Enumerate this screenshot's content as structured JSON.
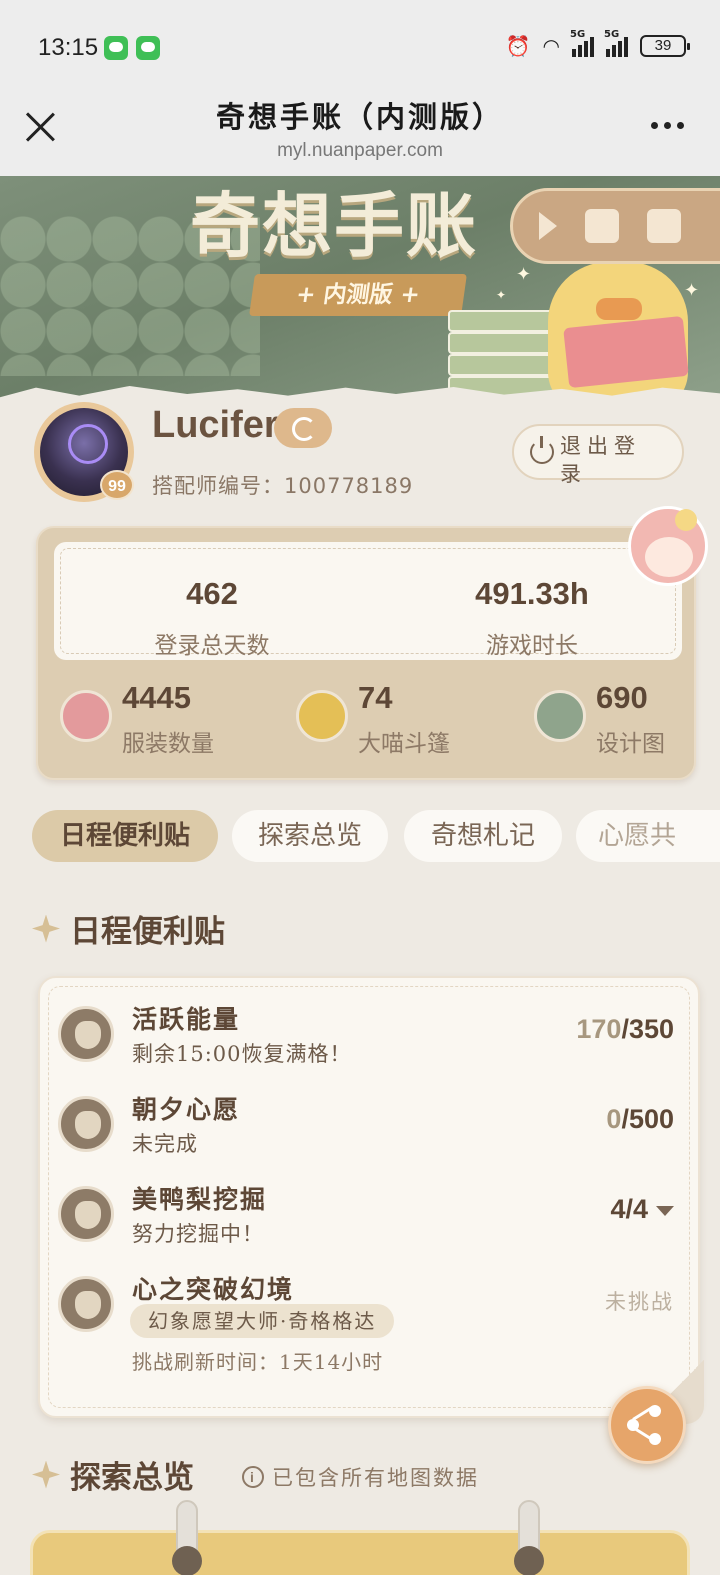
{
  "status_bar": {
    "time": "13:15",
    "network_label": "5G",
    "battery": "39"
  },
  "nav": {
    "title": "奇想手账（内测版）",
    "url": "myl.nuanpaper.com"
  },
  "banner": {
    "title": "奇想手账",
    "badge": "+ 内测版 +"
  },
  "profile": {
    "username": "Lucifer",
    "level": "99",
    "designer_id_label": "搭配师编号：",
    "designer_id": "100778189",
    "logout_label": "退出登录"
  },
  "stats": {
    "login_days": "462",
    "login_days_label": "登录总天数",
    "play_time": "491.33h",
    "play_time_label": "游戏时长",
    "outfits": "4445",
    "outfits_label": "服装数量",
    "cloaks": "74",
    "cloaks_label": "大喵斗篷",
    "designs": "690",
    "designs_label": "设计图"
  },
  "tabs": [
    "日程便利贴",
    "探索总览",
    "奇想札记",
    "心愿共"
  ],
  "schedule": {
    "heading": "日程便利贴",
    "rows": [
      {
        "title": "活跃能量",
        "sub": "剩余15:00恢复满格！",
        "value_dim": "170",
        "value": "/350"
      },
      {
        "title": "朝夕心愿",
        "sub": "未完成",
        "value_dim": "0",
        "value": "/500"
      },
      {
        "title": "美鸭梨挖掘",
        "sub": "努力挖掘中！",
        "value_dim": "",
        "value": "4/4"
      },
      {
        "title": "心之突破幻境",
        "chip": "幻象愿望大师·奇格格达",
        "sub": "挑战刷新时间：1天14小时",
        "status": "未挑战"
      }
    ]
  },
  "explore": {
    "heading": "探索总览",
    "note": "已包含所有地图数据"
  },
  "colors": {
    "accent": "#e6a56a",
    "brown": "#5d4736",
    "card": "#ddcdb2"
  }
}
